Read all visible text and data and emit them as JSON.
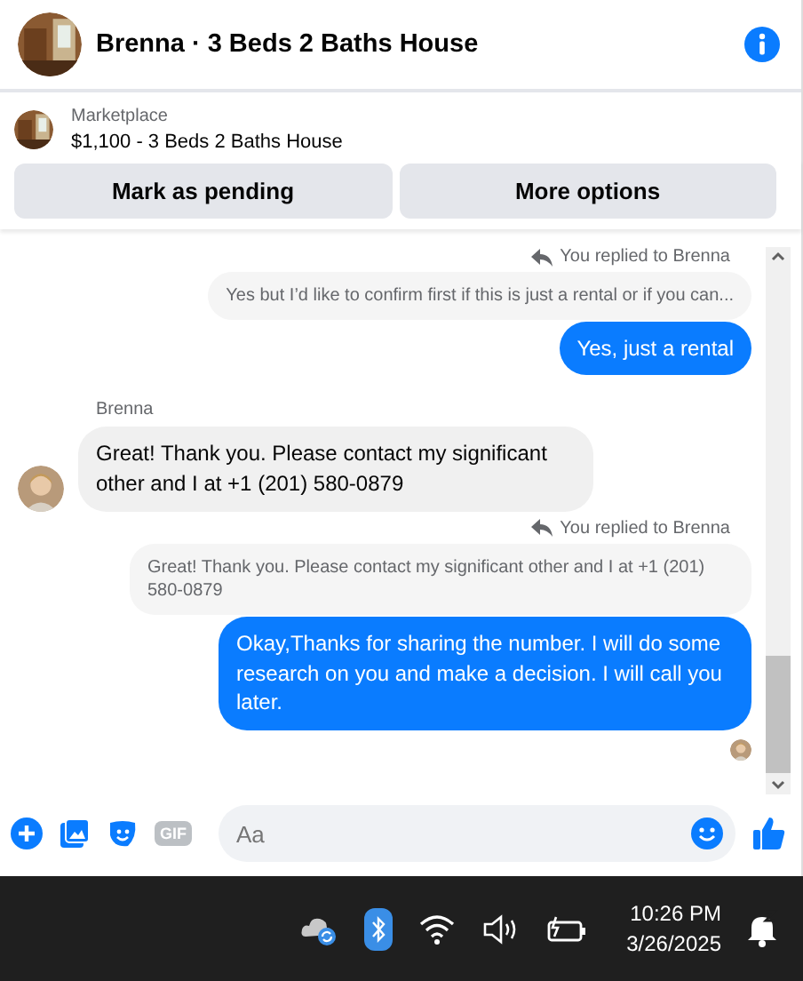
{
  "header": {
    "title": "Brenna · 3 Beds 2 Baths House"
  },
  "listing": {
    "source": "Marketplace",
    "title": "$1,100 - 3 Beds 2 Baths House"
  },
  "actions": [
    "Mark as pending",
    "More options"
  ],
  "messages": [
    {
      "kind": "reply",
      "note": "You replied to Brenna",
      "quote": "Yes but I’d like to confirm first if this is just a rental or if you can...",
      "text": "Yes, just a rental",
      "seen": false
    },
    {
      "kind": "incoming",
      "sender": "Brenna",
      "text": "Great! Thank you. Please contact my significant other and I at +1 (201) 580-0879"
    },
    {
      "kind": "reply",
      "note": "You replied to Brenna",
      "quote": "Great! Thank you. Please contact my significant other and I at +1 (201) 580-0879",
      "text": "Okay,Thanks for sharing the number. I will do some research on you and make a decision. I will call you later.",
      "seen": true
    }
  ],
  "composer": {
    "gif_label": "GIF",
    "placeholder": "Aa"
  },
  "taskbar": {
    "time": "10:26 PM",
    "date": "3/26/2025"
  }
}
